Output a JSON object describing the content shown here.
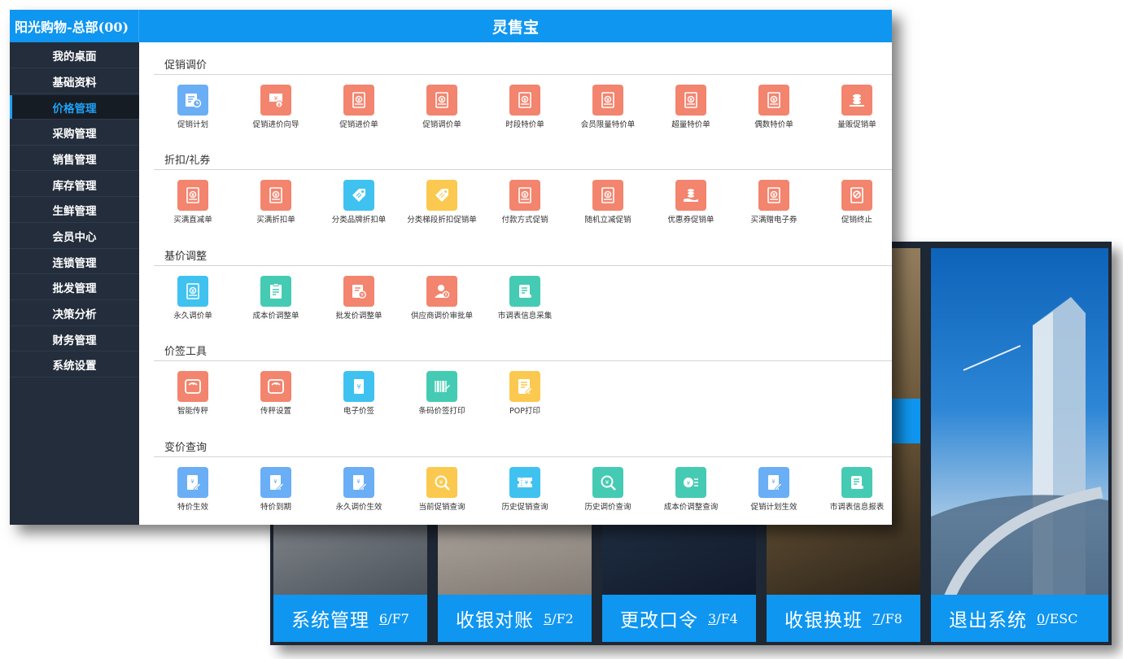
{
  "app": {
    "title": "灵售宝",
    "brand": "阳光购物-总部(00)"
  },
  "sidebar": {
    "items": [
      {
        "label": "我的桌面",
        "active": false
      },
      {
        "label": "基础资料",
        "active": false
      },
      {
        "label": "价格管理",
        "active": true
      },
      {
        "label": "采购管理",
        "active": false
      },
      {
        "label": "销售管理",
        "active": false
      },
      {
        "label": "库存管理",
        "active": false
      },
      {
        "label": "生鲜管理",
        "active": false
      },
      {
        "label": "会员中心",
        "active": false
      },
      {
        "label": "连锁管理",
        "active": false
      },
      {
        "label": "批发管理",
        "active": false
      },
      {
        "label": "决策分析",
        "active": false
      },
      {
        "label": "财务管理",
        "active": false
      },
      {
        "label": "系统设置",
        "active": false
      }
    ]
  },
  "sections": [
    {
      "title": "促销调价",
      "items": [
        {
          "label": "促销计划",
          "icon": "plan-clock-icon",
          "color": "#6aaef5"
        },
        {
          "label": "促销进价向导",
          "icon": "yuan-download-icon",
          "color": "#f3846e"
        },
        {
          "label": "促销进价单",
          "icon": "yuan-receipt-icon",
          "color": "#f3846e"
        },
        {
          "label": "促销调价单",
          "icon": "yuan-receipt-icon",
          "color": "#f3846e"
        },
        {
          "label": "时段特价单",
          "icon": "yuan-receipt-icon",
          "color": "#f3846e"
        },
        {
          "label": "会员限量特价单",
          "icon": "yuan-receipt-icon",
          "color": "#f3846e"
        },
        {
          "label": "超量特价单",
          "icon": "yuan-receipt-icon",
          "color": "#f3846e"
        },
        {
          "label": "偶数特价单",
          "icon": "yuan-receipt-icon",
          "color": "#f3846e"
        },
        {
          "label": "量贩促销单",
          "icon": "coin-stack-icon",
          "color": "#f3846e"
        }
      ]
    },
    {
      "title": "折扣/礼券",
      "items": [
        {
          "label": "买满直减单",
          "icon": "yuan-receipt-icon",
          "color": "#f3846e"
        },
        {
          "label": "买满折扣单",
          "icon": "yuan-receipt-icon",
          "color": "#f3846e"
        },
        {
          "label": "分类品牌折扣单",
          "icon": "price-tag-icon",
          "color": "#3fc2f0"
        },
        {
          "label": "分类梯段折扣促销单",
          "icon": "price-tag-icon",
          "color": "#fbc94f"
        },
        {
          "label": "付款方式促销",
          "icon": "yuan-receipt-icon",
          "color": "#f3846e"
        },
        {
          "label": "随机立减促销",
          "icon": "yuan-receipt-icon",
          "color": "#f3846e"
        },
        {
          "label": "优惠券促销单",
          "icon": "coin-hand-icon",
          "color": "#f3846e"
        },
        {
          "label": "买满赠电子券",
          "icon": "yuan-receipt-icon",
          "color": "#f3846e"
        },
        {
          "label": "促销终止",
          "icon": "stop-icon",
          "color": "#f3846e"
        }
      ]
    },
    {
      "title": "基价调整",
      "items": [
        {
          "label": "永久调价单",
          "icon": "yuan-receipt-icon",
          "color": "#3fc2f0"
        },
        {
          "label": "成本价调整单",
          "icon": "clipboard-icon",
          "color": "#45cbb3"
        },
        {
          "label": "批发价调整单",
          "icon": "doc-yuan-icon",
          "color": "#f3846e"
        },
        {
          "label": "供应商调价审批单",
          "icon": "user-approve-icon",
          "color": "#f3846e"
        },
        {
          "label": "市调表信息采集",
          "icon": "scroll-icon",
          "color": "#45cbb3"
        }
      ]
    },
    {
      "title": "价签工具",
      "items": [
        {
          "label": "智能传秤",
          "icon": "scale-icon",
          "color": "#f3846e"
        },
        {
          "label": "传秤设置",
          "icon": "scale-icon",
          "color": "#f3846e"
        },
        {
          "label": "电子价签",
          "icon": "yuan-tag-icon",
          "color": "#3fc2f0"
        },
        {
          "label": "条码价签打印",
          "icon": "barcode-icon",
          "color": "#45cbb3"
        },
        {
          "label": "POP打印",
          "icon": "doc-edit-icon",
          "color": "#fbc94f"
        }
      ]
    },
    {
      "title": "变价查询",
      "items": [
        {
          "label": "特价生效",
          "icon": "yuan-doc-icon",
          "color": "#6aaef5"
        },
        {
          "label": "特价到期",
          "icon": "yuan-doc-icon",
          "color": "#6aaef5"
        },
        {
          "label": "永久调价生效",
          "icon": "yuan-doc-icon",
          "color": "#6aaef5"
        },
        {
          "label": "当前促销查询",
          "icon": "search-yuan-icon",
          "color": "#fbc94f"
        },
        {
          "label": "历史促销查询",
          "icon": "ticket-yuan-icon",
          "color": "#3fc2f0"
        },
        {
          "label": "历史调价查询",
          "icon": "search-yuan-icon",
          "color": "#45cbb3"
        },
        {
          "label": "成本价调整查询",
          "icon": "coin-list-icon",
          "color": "#45cbb3"
        },
        {
          "label": "促销计划生效",
          "icon": "yuan-doc-icon",
          "color": "#6aaef5"
        },
        {
          "label": "市调表信息报表",
          "icon": "scroll-icon",
          "color": "#45cbb3"
        }
      ]
    }
  ],
  "launcher": {
    "tiles": [
      {
        "label": "系统管理",
        "num": "6",
        "key": "/F7"
      },
      {
        "label": "收银对账",
        "num": "5",
        "key": "/F2"
      },
      {
        "label": "更改口令",
        "num": "3",
        "key": "/F4"
      },
      {
        "label": "收银换班",
        "num": "7",
        "key": "/F8"
      },
      {
        "label": "退出系统",
        "num": "0",
        "key": "/ESC"
      }
    ]
  }
}
